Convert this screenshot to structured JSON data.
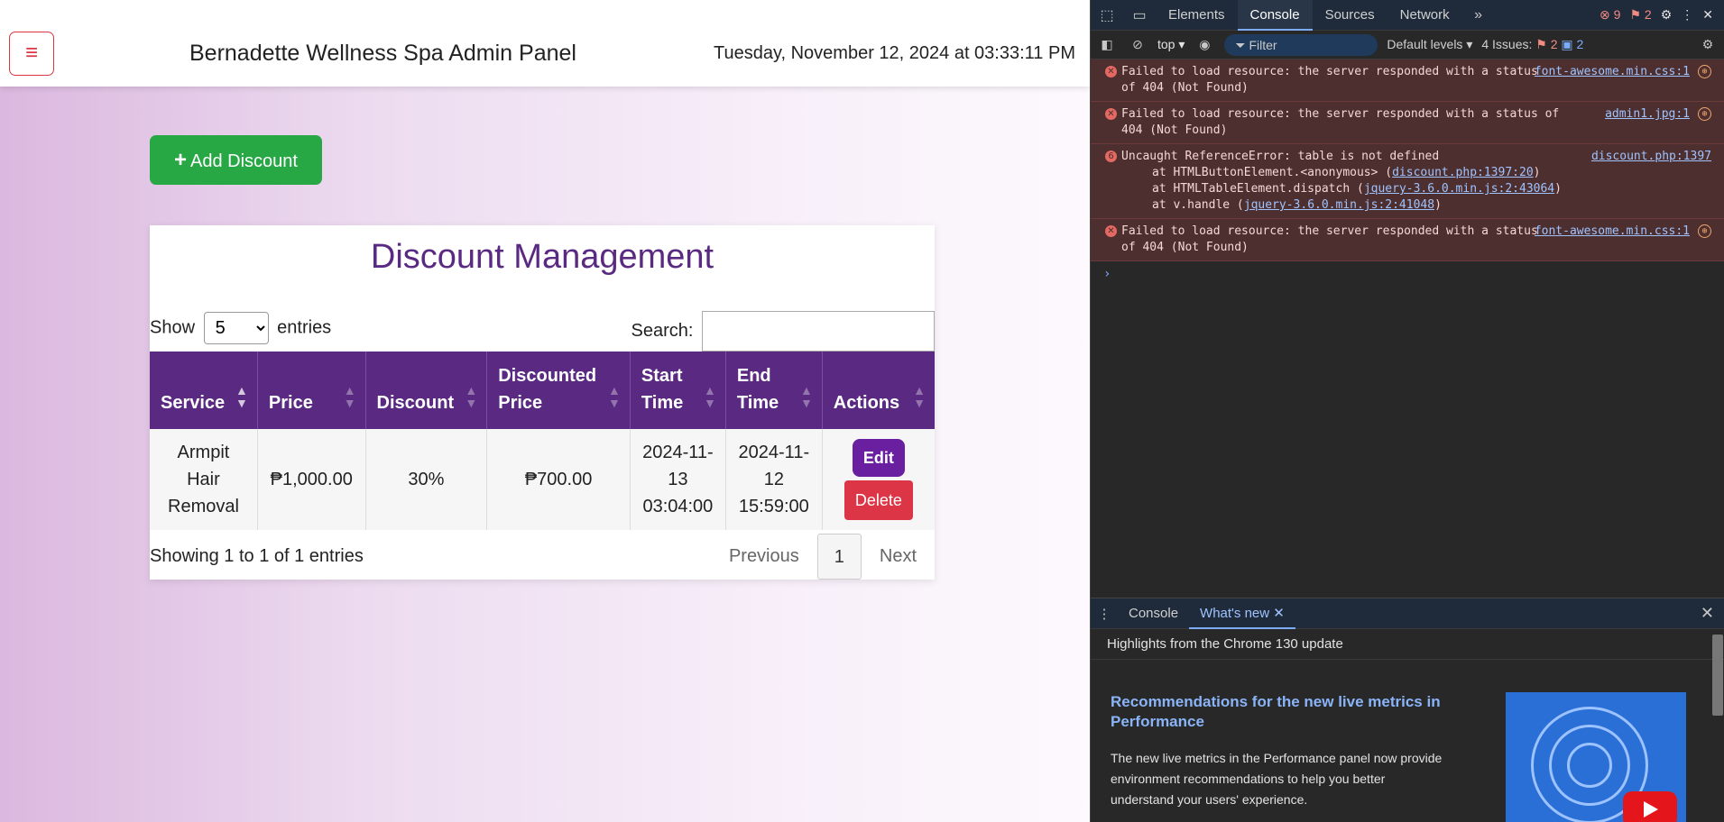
{
  "app": {
    "title": "Bernadette Wellness Spa Admin Panel",
    "datetime": "Tuesday, November 12, 2024 at 03:33:11 PM",
    "menu_icon": "≡"
  },
  "toolbar": {
    "add_label": "Add Discount"
  },
  "card": {
    "title": "Discount Management",
    "show_label": "Show",
    "entries_label": "entries",
    "page_size": "5",
    "search_label": "Search:",
    "search_value": ""
  },
  "table": {
    "headers": {
      "service": "Service",
      "price": "Price",
      "discount": "Discount",
      "discounted_price": "Discounted Price",
      "start_time": "Start Time",
      "end_time": "End Time",
      "actions": "Actions"
    },
    "rows": [
      {
        "service": "Armpit Hair Removal",
        "price": "₱1,000.00",
        "discount": "30%",
        "discounted_price": "₱700.00",
        "start_time": "2024-11-13 03:04:00",
        "end_time": "2024-11-12 15:59:00",
        "edit_label": "Edit",
        "delete_label": "Delete"
      }
    ],
    "info": "Showing 1 to 1 of 1 entries",
    "pager": {
      "previous": "Previous",
      "current": "1",
      "next": "Next"
    }
  },
  "devtools": {
    "tabs": [
      "Elements",
      "Console",
      "Sources",
      "Network"
    ],
    "active_tab": "Console",
    "error_count": "9",
    "warning_count": "2",
    "context": "top",
    "filter_placeholder": "Filter",
    "levels": "Default levels",
    "issues_label": "4 Issues:",
    "issues_red": "2",
    "issues_blue": "2",
    "messages": [
      {
        "text": "Failed to load resource: the server responded with a status of 404 (Not Found)",
        "src": "font-awesome.min.css:1"
      },
      {
        "text": "Failed to load resource: the server responded with a status of 404 (Not Found)",
        "src": "admin1.jpg:1"
      },
      {
        "text": "Uncaught ReferenceError: table is not defined",
        "src": "discount.php:1397",
        "count": "6",
        "stack": [
          {
            "pre": "at HTMLButtonElement.<anonymous> (",
            "link": "discount.php:1397:20",
            "post": ")"
          },
          {
            "pre": "at HTMLTableElement.dispatch (",
            "link": "jquery-3.6.0.min.js:2:43064",
            "post": ")"
          },
          {
            "pre": "at v.handle (",
            "link": "jquery-3.6.0.min.js:2:41048",
            "post": ")"
          }
        ]
      },
      {
        "text": "Failed to load resource: the server responded with a status of 404 (Not Found)",
        "src": "font-awesome.min.css:1"
      }
    ],
    "drawer": {
      "tabs": [
        "Console",
        "What's new"
      ],
      "active_tab": "What's new",
      "highlights": "Highlights from the Chrome 130 update",
      "wn_title": "Recommendations for the new live metrics in Performance",
      "wn_body": "The new live metrics in the Performance panel now provide environment recommendations to help you better understand your users' experience."
    }
  }
}
